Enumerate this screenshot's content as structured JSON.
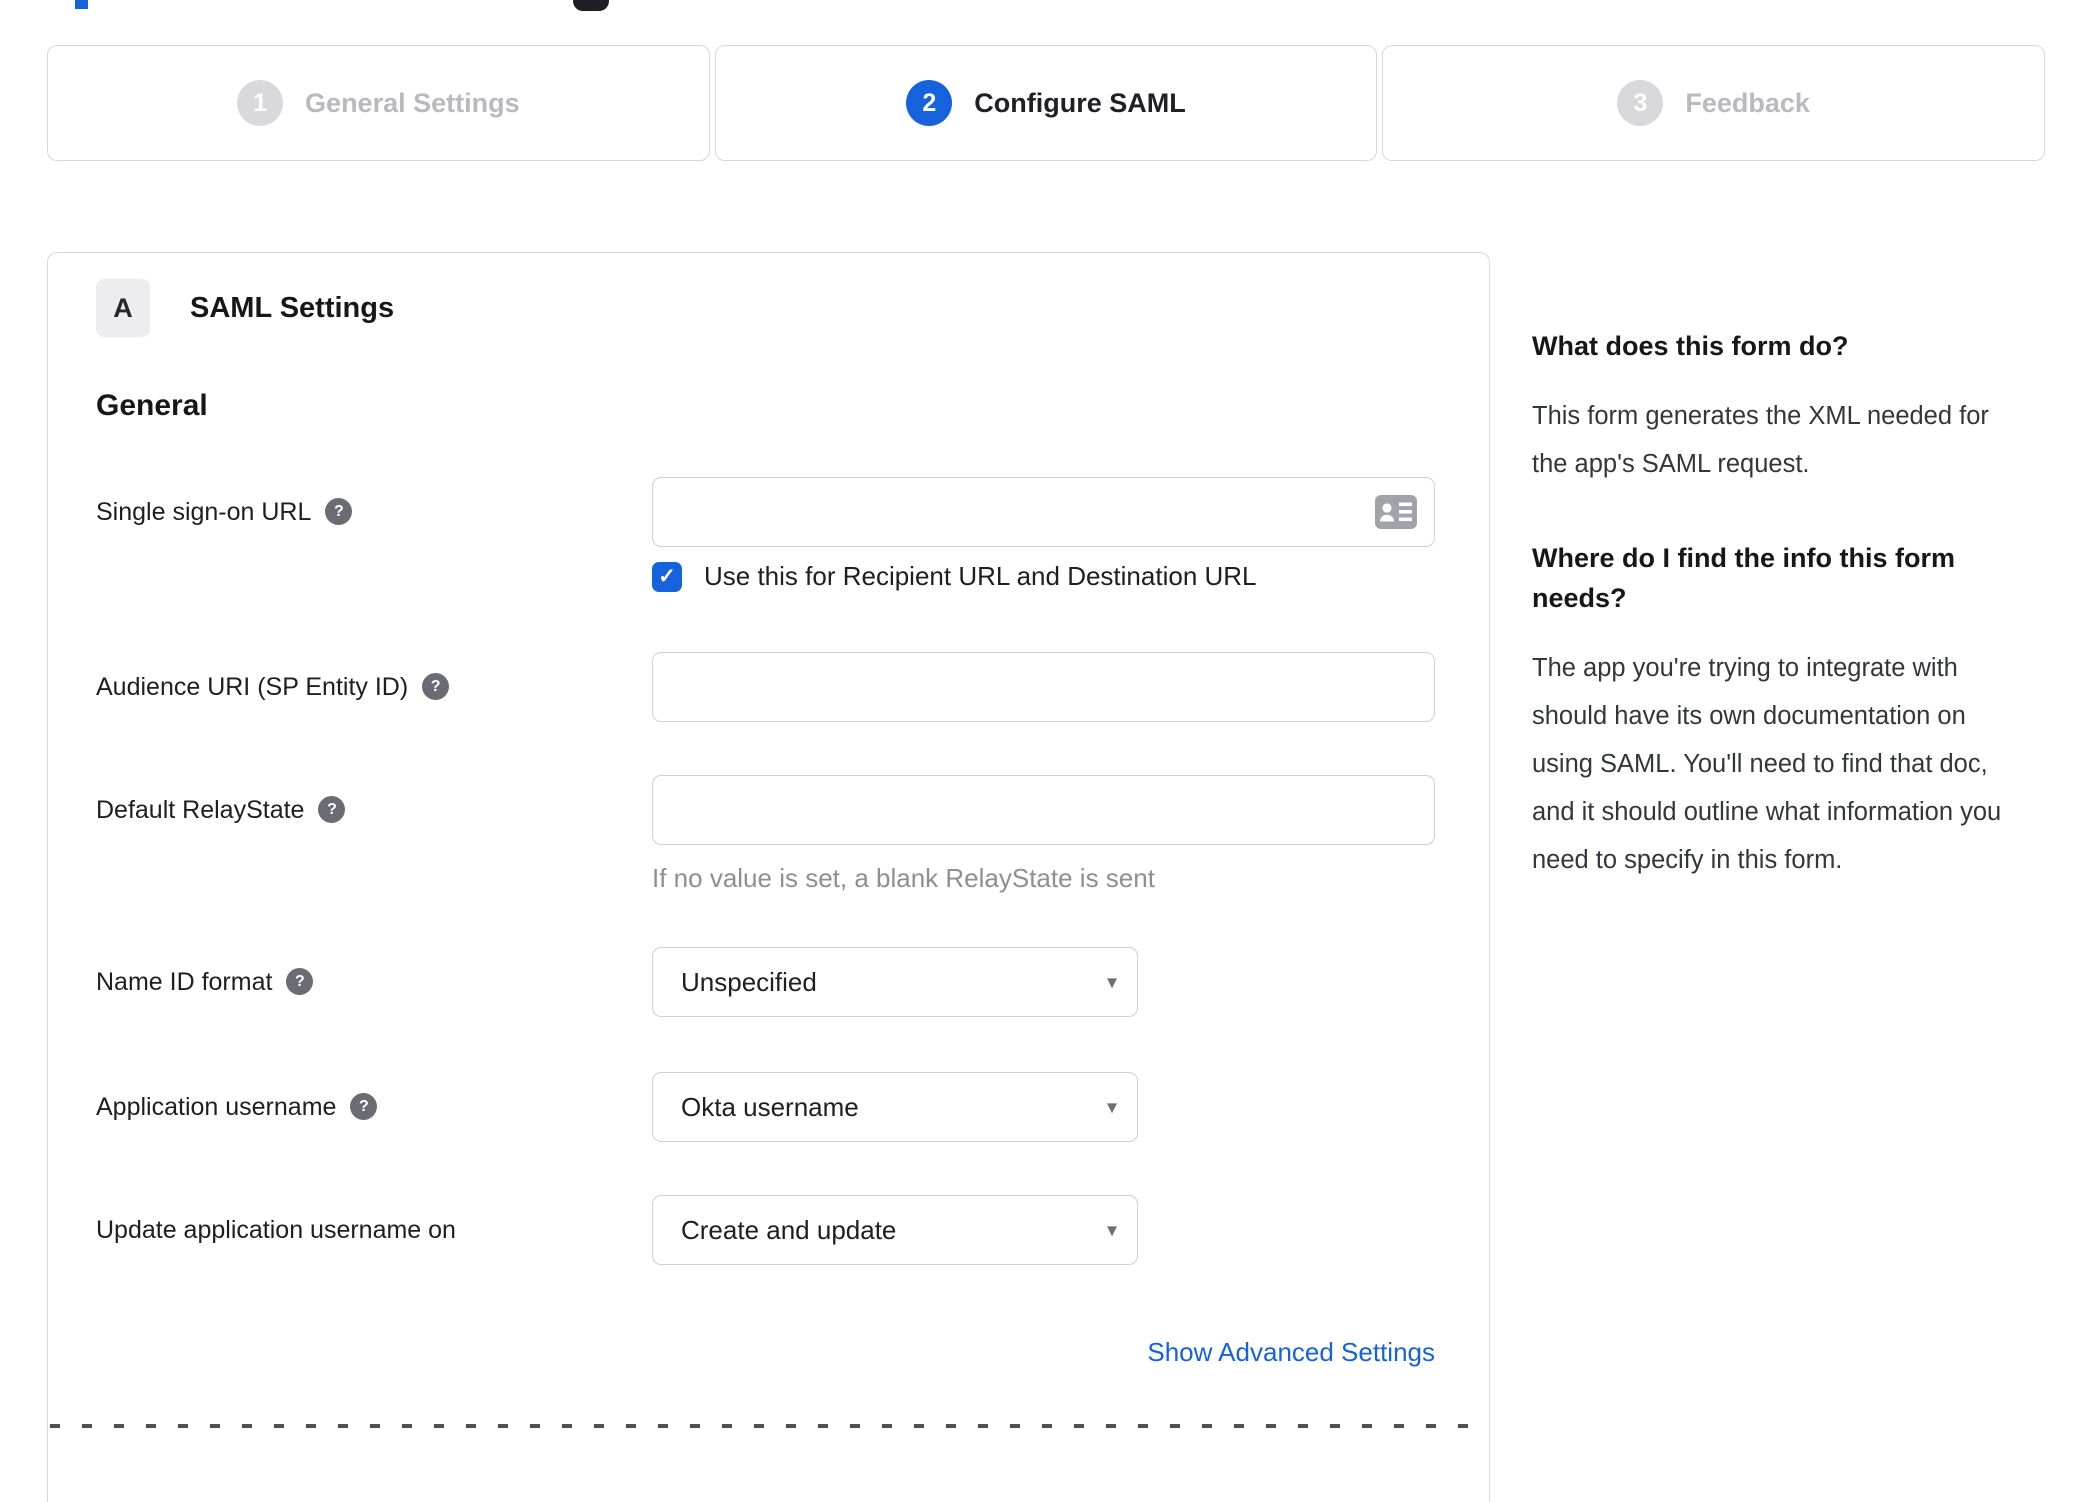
{
  "colors": {
    "accent_blue": "#1662dd",
    "link_blue": "#1662dd",
    "inactive_gray": "#b9b9bf"
  },
  "icons": {
    "help_glyph": "?",
    "check_glyph": "✓",
    "dropdown_arrow_glyph": "▾"
  },
  "stepper": {
    "steps": [
      {
        "number": "1",
        "label": "General Settings",
        "state": "inactive"
      },
      {
        "number": "2",
        "label": "Configure SAML",
        "state": "active"
      },
      {
        "number": "3",
        "label": "Feedback",
        "state": "inactive"
      }
    ]
  },
  "panel": {
    "section_badge": "A",
    "section_title": "SAML Settings",
    "group_heading": "General",
    "fields": {
      "sso_url": {
        "label": "Single sign-on URL",
        "value": "",
        "checkbox_label": "Use this for Recipient URL and Destination URL",
        "checkbox_checked": true
      },
      "audience_uri": {
        "label": "Audience URI (SP Entity ID)",
        "value": ""
      },
      "relay_state": {
        "label": "Default RelayState",
        "value": "",
        "hint": "If no value is set, a blank RelayState is sent"
      },
      "name_id_format": {
        "label": "Name ID format",
        "value": "Unspecified"
      },
      "app_username": {
        "label": "Application username",
        "value": "Okta username"
      },
      "update_username": {
        "label": "Update application username on",
        "value": "Create and update"
      }
    },
    "advanced_link": "Show Advanced Settings"
  },
  "sidebar": {
    "sections": [
      {
        "title": "What does this form do?",
        "body": "This form generates the XML needed for the app's SAML request."
      },
      {
        "title": "Where do I find the info this form needs?",
        "body": "The app you're trying to integrate with should have its own documentation on using SAML. You'll need to find that doc, and it should outline what information you need to specify in this form."
      }
    ]
  }
}
